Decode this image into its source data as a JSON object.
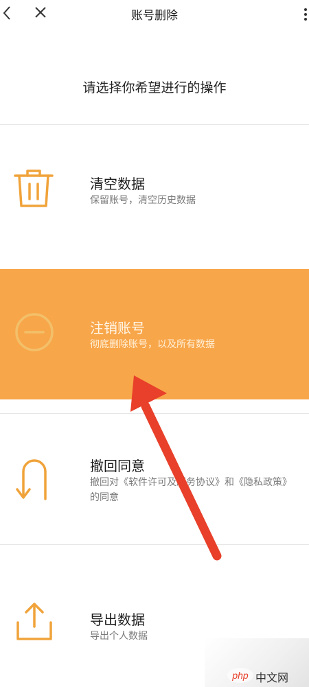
{
  "header": {
    "title": "账号删除",
    "back_icon": "chevron-left-icon",
    "close_icon": "close-icon",
    "more_icon": "more-vertical-icon"
  },
  "subtitle": "请选择你希望进行的操作",
  "options": [
    {
      "label": "清空数据",
      "desc": "保留账号，清空历史数据",
      "icon": "trash-icon"
    },
    {
      "label": "注销账号",
      "desc": "彻底删除账号，以及所有数据",
      "icon": "minus-circle-icon"
    },
    {
      "label": "撤回同意",
      "desc": "撤回对《软件许可及服务协议》和《隐私政策》的同意",
      "icon": "u-turn-arrow-icon"
    },
    {
      "label": "导出数据",
      "desc": "导出个人数据",
      "icon": "export-icon"
    }
  ],
  "colors": {
    "accent": "#f0a33a",
    "highlight_bg": "#f8a64a",
    "annotation_arrow": "#e8402a"
  },
  "watermark": {
    "text": "中文网",
    "logo": "php"
  }
}
